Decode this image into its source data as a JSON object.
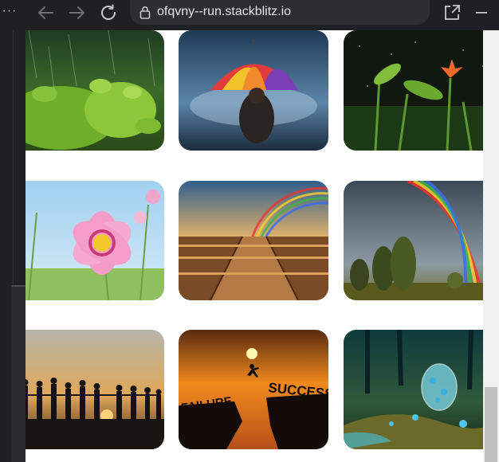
{
  "browser": {
    "menu_glyph": "···",
    "url": "ofqvny--run.stackblitz.io",
    "icons": [
      "menu-dots-icon",
      "back-arrow-icon",
      "forward-arrow-icon",
      "reload-icon",
      "lock-icon",
      "open-external-icon",
      "minimize-icon"
    ]
  },
  "gallery": {
    "tiles": [
      {
        "name": "rain-leaves",
        "subject": "green leaves in rain"
      },
      {
        "name": "rainbow-umbrella",
        "subject": "person with rainbow umbrella in rain"
      },
      {
        "name": "rain-flowers-night",
        "subject": "orange lily in night rain"
      },
      {
        "name": "pink-cosmos",
        "subject": "pink cosmos flower"
      },
      {
        "name": "rainbow-boardwalk",
        "subject": "rainbow over wooden boardwalk"
      },
      {
        "name": "rainbow-trees",
        "subject": "rainbow over trees"
      },
      {
        "name": "sunset-silhouettes",
        "subject": "people holding hands at sunset"
      },
      {
        "name": "failure-success",
        "subject": "jump from failure to success cliffs"
      },
      {
        "name": "crystal-egg",
        "subject": "glass egg with blue flowers"
      }
    ],
    "failure_text": "FAILURE",
    "success_text": "SUCCESS"
  },
  "colors": {
    "chrome_bg": "#1f2023",
    "urlbar_bg": "#2d2e32",
    "content_bg": "#ffffff"
  }
}
